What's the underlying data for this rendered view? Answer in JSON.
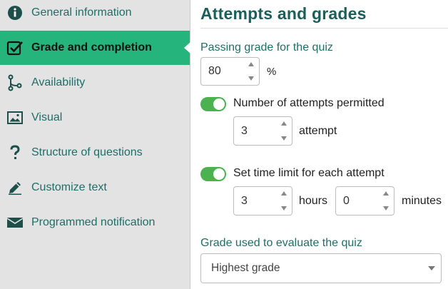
{
  "sidebar": {
    "items": [
      {
        "label": "General information",
        "icon": "info-icon"
      },
      {
        "label": "Grade and completion",
        "icon": "checkbox-checked-icon",
        "active": true
      },
      {
        "label": "Availability",
        "icon": "branch-icon"
      },
      {
        "label": "Visual",
        "icon": "image-icon"
      },
      {
        "label": "Structure of questions",
        "icon": "question-mark-icon"
      },
      {
        "label": "Customize text",
        "icon": "pencil-icon"
      },
      {
        "label": "Programmed notification",
        "icon": "envelope-icon"
      }
    ]
  },
  "main": {
    "title": "Attempts and grades",
    "passing_grade": {
      "label": "Passing grade for the quiz",
      "value": "80",
      "unit": "%"
    },
    "attempts": {
      "label": "Number of attempts permitted",
      "enabled": true,
      "value": "3",
      "unit": "attempt"
    },
    "time_limit": {
      "label": "Set time limit for each attempt",
      "enabled": true,
      "hours_value": "3",
      "hours_unit": "hours",
      "minutes_value": "0",
      "minutes_unit": "minutes"
    },
    "grade_method": {
      "label": "Grade used to evaluate the quiz",
      "selected": "Highest grade"
    }
  },
  "colors": {
    "accent": "#25b57c",
    "toggle_on": "#4cb14f",
    "heading": "#1a5f5a",
    "label": "#1f6e68",
    "sidebar_bg": "#e3e3e3"
  }
}
